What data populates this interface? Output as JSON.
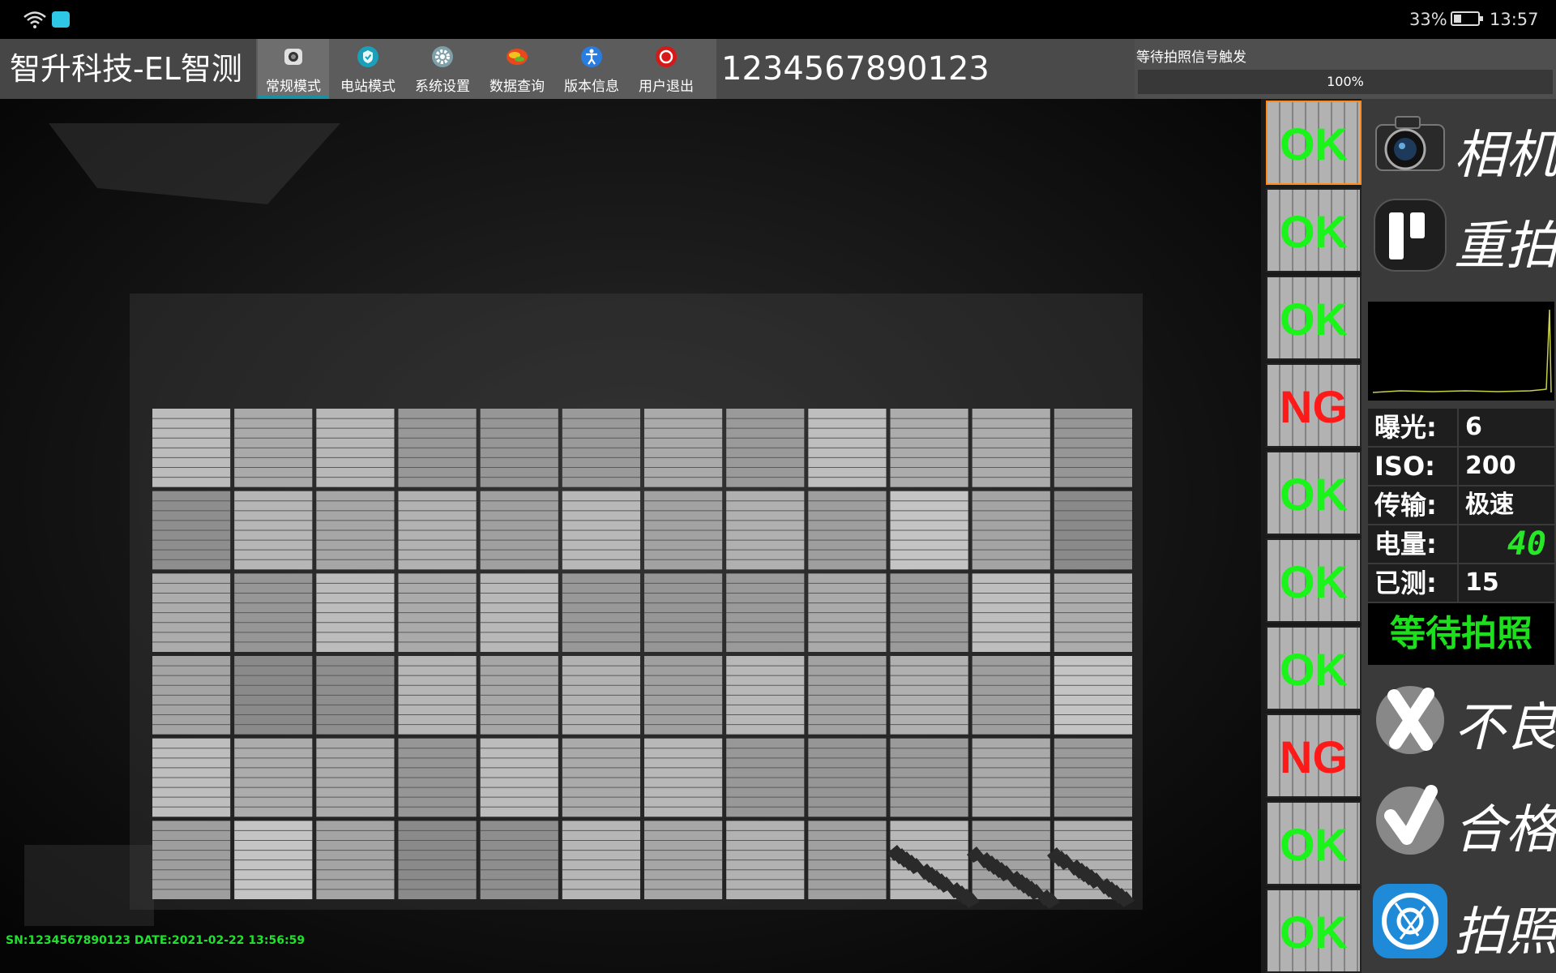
{
  "status_bar": {
    "battery": "33%",
    "battery_level": 0.33,
    "time": "13:57",
    "wifi_icon": "wifi-icon",
    "app_icon": "app-icon"
  },
  "toolbar": {
    "title": "智升科技-EL智测",
    "tabs": [
      {
        "label": "常规模式",
        "icon": "camera-icon",
        "color": "#dddddd",
        "active": true
      },
      {
        "label": "电站模式",
        "icon": "shield-icon",
        "color": "#1aa0b8",
        "active": false
      },
      {
        "label": "系统设置",
        "icon": "gear-icon",
        "color": "#8fa8b0",
        "active": false
      },
      {
        "label": "数据查询",
        "icon": "database-icon",
        "color": "#e8481e",
        "active": false
      },
      {
        "label": "版本信息",
        "icon": "info-person-icon",
        "color": "#2a7de0",
        "active": false
      },
      {
        "label": "用户退出",
        "icon": "power-icon",
        "color": "#d81818",
        "active": false
      }
    ],
    "sn_value": "1234567890123",
    "trigger_label": "等待拍照信号触发",
    "progress_text": "100%",
    "progress_value": 1.0
  },
  "viewer": {
    "caption": "SN:1234567890123   DATE:2021-02-22 13:56:59"
  },
  "thumbs": [
    "OK",
    "OK",
    "OK",
    "NG",
    "OK",
    "OK",
    "OK",
    "NG",
    "OK",
    "OK"
  ],
  "colors": {
    "ok": "#1af41a",
    "ng": "#ff1a1a",
    "accent": "#1e8f9e",
    "selected": "#ff8a1e"
  },
  "right_panel": {
    "camera_label": "相机",
    "retake_label": "重拍",
    "params": [
      {
        "key": "曝光:",
        "value": "6"
      },
      {
        "key": "ISO:",
        "value": "200"
      },
      {
        "key": "传输:",
        "value": "极速"
      },
      {
        "key": "电量:",
        "value": "40"
      },
      {
        "key": "已测:",
        "value": "15"
      }
    ],
    "status": "等待拍照",
    "bad_label": "不良",
    "pass_label": "合格",
    "shoot_label": "拍照"
  }
}
